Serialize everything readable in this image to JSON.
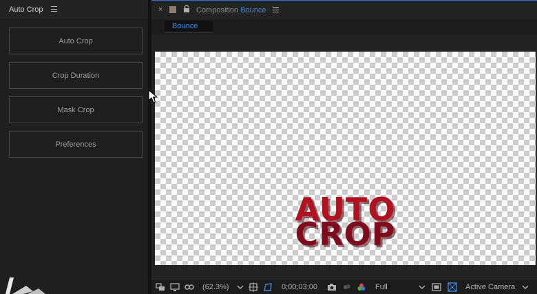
{
  "left_panel": {
    "title": "Auto Crop",
    "buttons": [
      {
        "label": "Auto Crop"
      },
      {
        "label": "Crop Duration"
      },
      {
        "label": "Mask Crop"
      },
      {
        "label": "Preferences"
      }
    ]
  },
  "composition_panel": {
    "title_prefix": "Composition",
    "comp_name": "Bounce",
    "tab_label": "Bounce"
  },
  "canvas_art": {
    "line1": "AUTO",
    "line2": "CROP"
  },
  "toolbar": {
    "zoom": "(62.3%)",
    "timecode": "0;00;03;00",
    "resolution": "Full",
    "camera": "Active Camera"
  },
  "icons": [
    "menu-icon",
    "close-icon",
    "lock-icon",
    "region-icon",
    "monitor-icon",
    "mask-icon",
    "chevron-down-icon",
    "safe-area-icon",
    "transparency-grid-icon",
    "camera-icon",
    "color-wheel-icon",
    "fast-preview-icon",
    "grid-icon",
    "ae-logo-icon",
    "mouse-pointer-icon"
  ],
  "colors": {
    "accent_blue": "#3d8ee6",
    "panel_bg": "#232323",
    "art_red": "#b01220",
    "art_dark_red": "#7e0c1d"
  }
}
